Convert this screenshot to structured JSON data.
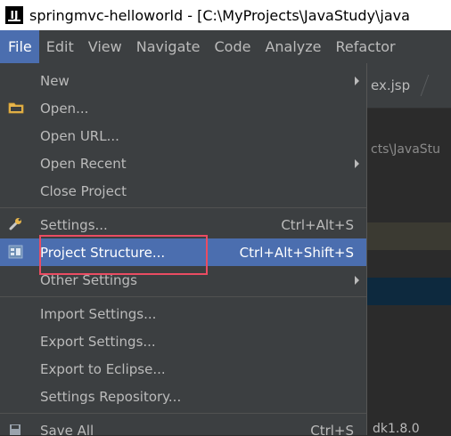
{
  "window": {
    "app_icon_text": "IJ",
    "title": "springmvc-helloworld - [C:\\MyProjects\\JavaStudy\\java"
  },
  "menubar": [
    {
      "label": "File",
      "active": true
    },
    {
      "label": "Edit"
    },
    {
      "label": "View"
    },
    {
      "label": "Navigate"
    },
    {
      "label": "Code"
    },
    {
      "label": "Analyze"
    },
    {
      "label": "Refactor"
    }
  ],
  "background": {
    "tab_label": "ex.jsp",
    "path_label": "cts\\JavaStu",
    "bottom_text": "dk1.8.0"
  },
  "file_menu": {
    "new": "New",
    "open": "Open...",
    "open_url": "Open URL...",
    "open_recent": "Open Recent",
    "close_project": "Close Project",
    "settings": "Settings...",
    "settings_shortcut": "Ctrl+Alt+S",
    "project_structure": "Project Structure...",
    "project_structure_shortcut": "Ctrl+Alt+Shift+S",
    "other_settings": "Other Settings",
    "import_settings": "Import Settings...",
    "export_settings": "Export Settings...",
    "export_eclipse": "Export to Eclipse...",
    "settings_repository": "Settings Repository...",
    "save_all": "Save All",
    "save_all_shortcut": "Ctrl+S"
  },
  "colors": {
    "selection": "#4b6eaf",
    "annotation": "#ea4c62",
    "menu_bg": "#3c3f41"
  }
}
